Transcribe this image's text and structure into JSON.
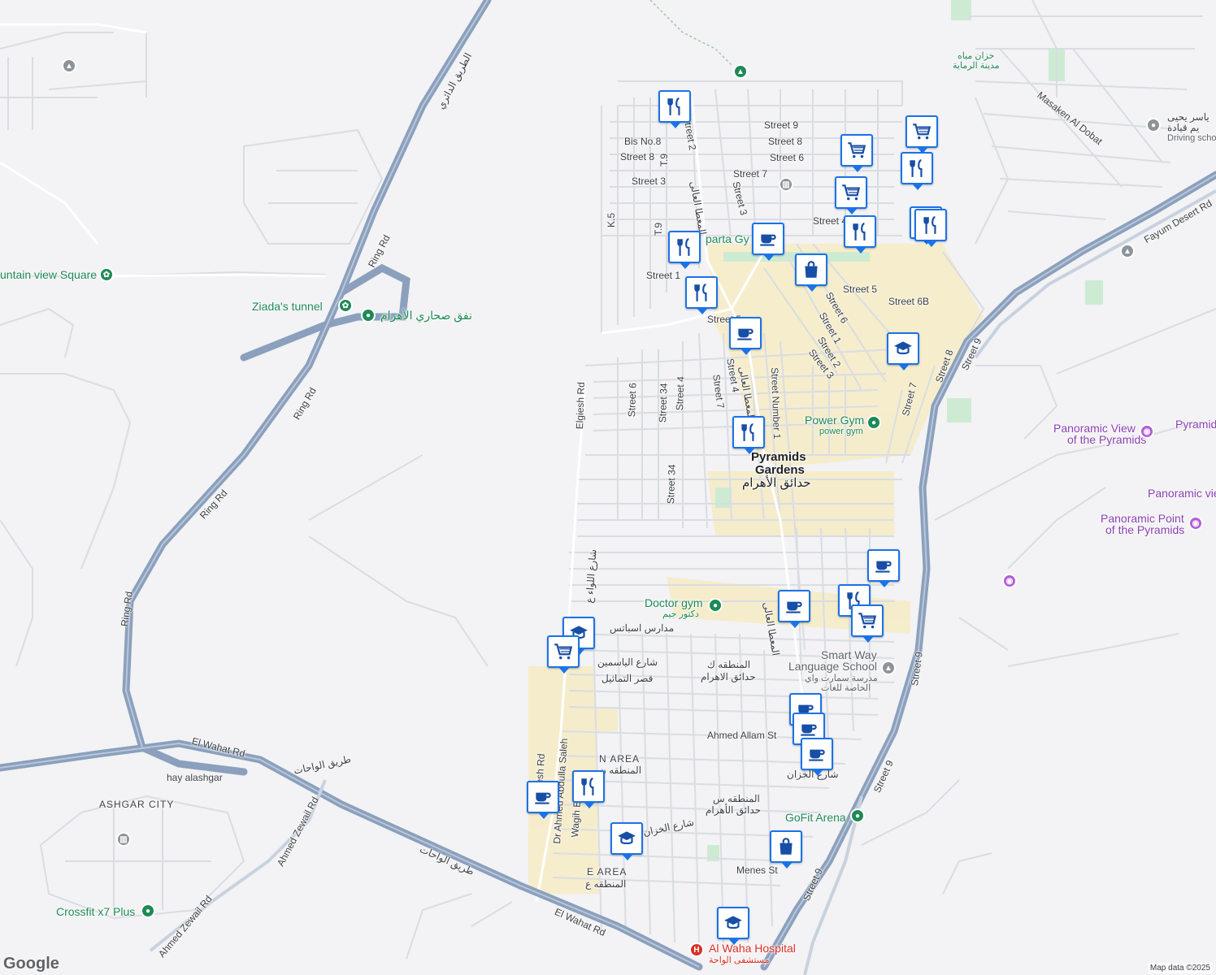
{
  "map": {
    "attribution": "Map data ©2025",
    "logo": "Google",
    "colors": {
      "background": "#f3f2f4",
      "highway": "#8a9bb5",
      "road": "#ffffff",
      "pin_border": "#1a73e8",
      "pin_icon": "#174ea6",
      "park": "#1e8a55",
      "highlight": "#f6e7b9"
    }
  },
  "roads": {
    "ring_rd": "Ring Rd",
    "ring_rd_arabic": "الطريق الدائري",
    "el_wahat": "El Wahat Rd",
    "el_wahat_arabic": "طريق الواحات",
    "fayum_desert": "Fayum Desert Rd",
    "street9": "Street 9",
    "ahmed_zewail": "Ahmed Zewail Rd",
    "elgiesh": "Elgiesh Rd",
    "street1": "Street 1",
    "street2": "Street 2",
    "street3": "Street 3",
    "street4": "Street 4",
    "street5": "Street 5",
    "street6": "Street 6",
    "street6b": "Street 6B",
    "street7": "Street 7",
    "street8": "Street 8",
    "street34": "Street 34",
    "street_number1": "Street Number 1",
    "bis_no8": "Bis No.8",
    "t9": "T.9",
    "k5": "K.5",
    "masaken": "Masaken Al Dobat",
    "hay_alashgar": "hay alashgar",
    "ahmed_allam": "Ahmed Allam St",
    "menes": "Menes St",
    "dr_ahmed": "Dr Ahmed Abdulla Saleh",
    "wagih": "Wagih El",
    "yasmine": "شارع الياسمين",
    "tamathil": "قصر التماثيل",
    "schools": "مدارس اسباتس",
    "liwaa": "شارع اللواء ع",
    "khazan": "شارع الخزان",
    "mother": "المعطا العالى"
  },
  "places": {
    "mountain_view": "untain view Square",
    "ziada_tunnel": "Ziada's tunnel",
    "ahram_tunnel_ar": "نفق صحاري الأهرام",
    "spartan_gym": "parta Gy",
    "power_gym": "Power Gym",
    "power_gym_sub": "power gym",
    "panoramic_view": "Panoramic View of the Pyramids",
    "panoramic_view_l1": "Panoramic View",
    "panoramic_view_l2": "of the Pyramids",
    "pyramid_edge": "Pyramid",
    "panoramic_edge": "Panoramic vie",
    "panoramic_point_l1": "Panoramic Point",
    "panoramic_point_l2": "of the Pyramids",
    "doctor_gym": "Doctor gym",
    "doctor_gym_ar": "دكتور جيم",
    "smart_way_l1": "Smart Way",
    "smart_way_l2": "Language School",
    "smart_way_ar1": "مدرسة سمارت واي",
    "smart_way_ar2": "الخاصة للغات",
    "gofit": "GoFit Arena",
    "crossfit": "Crossfit x7 Plus",
    "al_waha": "Al Waha Hospital",
    "al_waha_ar": "مستشفى الواحة",
    "driving_school": "Driving scho",
    "driving_ar": "ياسر يحيى",
    "driving_ar2": "يم قيادة",
    "water_tanks_ar": "خزان مياه",
    "water_tanks_ar2": "مدينة الرماية"
  },
  "areas": {
    "pyramids_gardens_l1": "Pyramids",
    "pyramids_gardens_l2": "Gardens",
    "pyramids_gardens_ar": "حدائق الأهرام",
    "ashgar_city": "ASHGAR CITY",
    "n_area": "N AREA",
    "n_area_ar": "المنطقه ن",
    "e_area": "E AREA",
    "e_area_ar": "المنطقه ع",
    "k_area_ar": "المنطقه ك",
    "k_area_ar2": "حدائق الاهرام",
    "s_area_ar": "المنطقه س",
    "s_area_ar2": "حدائق الأهرام"
  },
  "pins": [
    {
      "type": "restaurant"
    },
    {
      "type": "shopping-cart"
    },
    {
      "type": "shopping-cart"
    },
    {
      "type": "restaurant"
    },
    {
      "type": "shopping-cart"
    },
    {
      "type": "restaurant"
    },
    {
      "type": "restaurant"
    },
    {
      "type": "cafe"
    },
    {
      "type": "restaurant"
    },
    {
      "type": "shopping-bag"
    },
    {
      "type": "restaurant"
    },
    {
      "type": "cafe"
    },
    {
      "type": "school"
    },
    {
      "type": "restaurant"
    },
    {
      "type": "cafe"
    },
    {
      "type": "cafe"
    },
    {
      "type": "restaurant"
    },
    {
      "type": "shopping-cart"
    },
    {
      "type": "school"
    },
    {
      "type": "shopping-cart"
    },
    {
      "type": "cafe"
    },
    {
      "type": "cafe"
    },
    {
      "type": "cafe"
    },
    {
      "type": "cafe"
    },
    {
      "type": "restaurant"
    },
    {
      "type": "school"
    },
    {
      "type": "shopping-bag"
    },
    {
      "type": "school"
    },
    {
      "type": "restaurant"
    }
  ]
}
